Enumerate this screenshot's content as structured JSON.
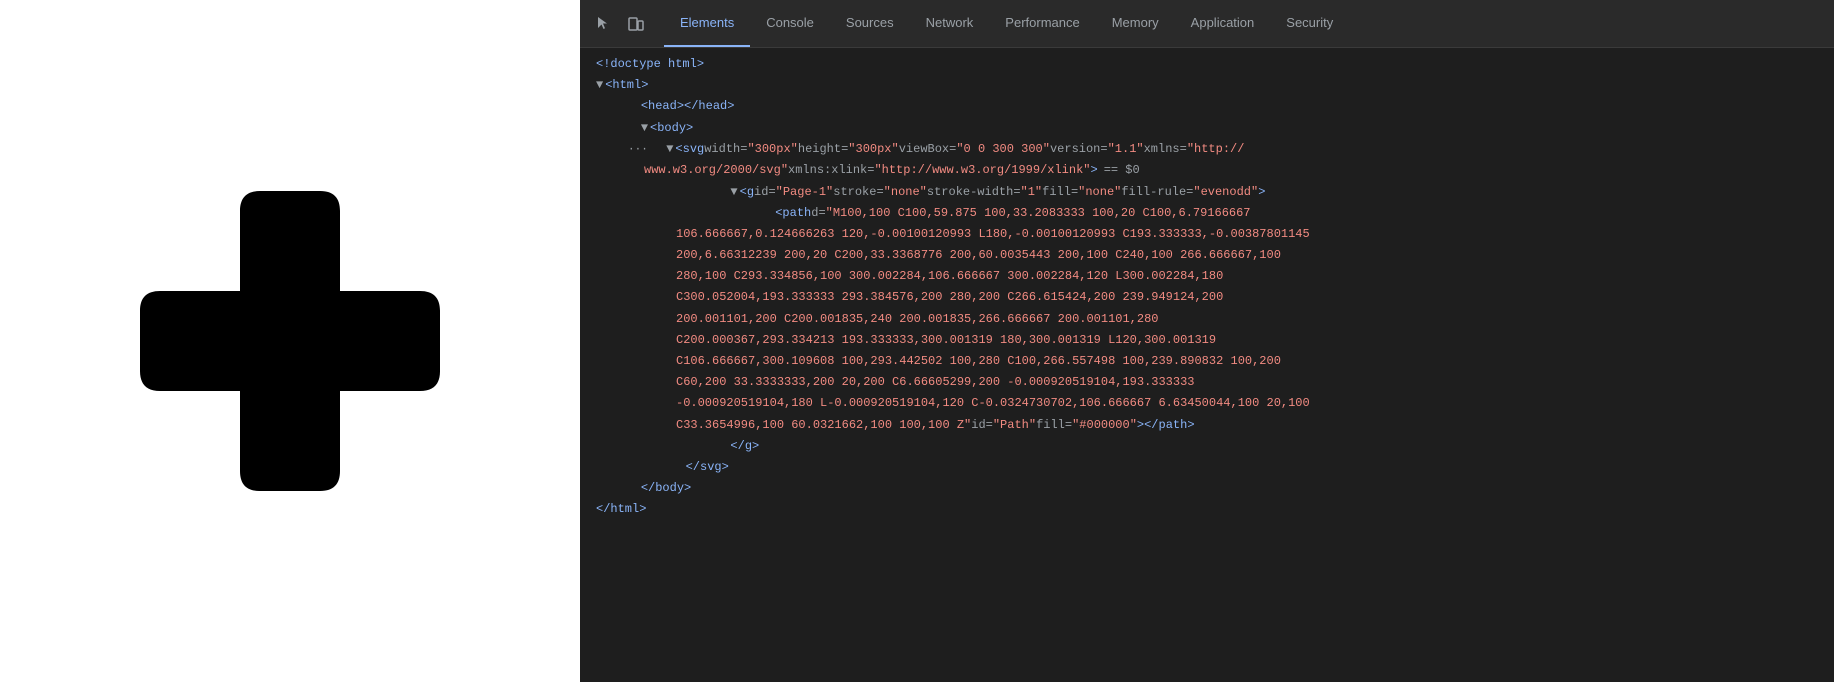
{
  "left_panel": {
    "bg_color": "#ffffff"
  },
  "devtools": {
    "tabs": [
      {
        "label": "Elements",
        "active": true
      },
      {
        "label": "Console",
        "active": false
      },
      {
        "label": "Sources",
        "active": false
      },
      {
        "label": "Network",
        "active": false
      },
      {
        "label": "Performance",
        "active": false
      },
      {
        "label": "Memory",
        "active": false
      },
      {
        "label": "Application",
        "active": false
      },
      {
        "label": "Security",
        "active": false
      }
    ],
    "code_lines": [
      {
        "indent": 0,
        "content": "doctype_line"
      },
      {
        "indent": 0,
        "content": "html_open"
      },
      {
        "indent": 1,
        "content": "head_line"
      },
      {
        "indent": 1,
        "content": "body_open"
      },
      {
        "indent": 2,
        "content": "svg_line"
      },
      {
        "indent": 3,
        "content": "g_open"
      },
      {
        "indent": 4,
        "content": "path_open"
      },
      {
        "indent": 5,
        "content": "path_data_1"
      },
      {
        "indent": 5,
        "content": "path_data_2"
      },
      {
        "indent": 5,
        "content": "path_data_3"
      },
      {
        "indent": 5,
        "content": "path_data_4"
      },
      {
        "indent": 5,
        "content": "path_data_5"
      },
      {
        "indent": 5,
        "content": "path_data_6"
      },
      {
        "indent": 5,
        "content": "path_data_7"
      },
      {
        "indent": 5,
        "content": "path_data_8"
      },
      {
        "indent": 5,
        "content": "path_data_9"
      },
      {
        "indent": 5,
        "content": "path_end"
      },
      {
        "indent": 3,
        "content": "g_close"
      },
      {
        "indent": 2,
        "content": "svg_close"
      },
      {
        "indent": 1,
        "content": "body_close"
      },
      {
        "indent": 0,
        "content": "html_close"
      }
    ]
  }
}
